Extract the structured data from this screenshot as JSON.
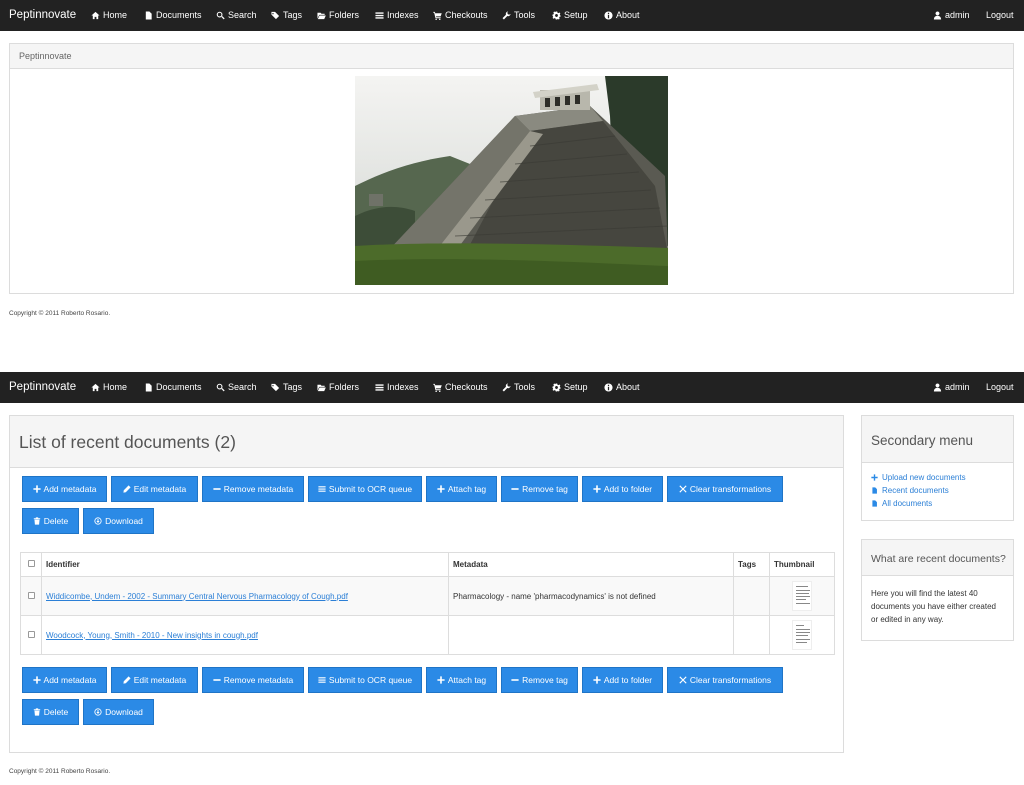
{
  "nav": {
    "brand": "Peptinnovate",
    "items": [
      {
        "label": "Home",
        "icon": "home-icon"
      },
      {
        "label": "Documents",
        "icon": "document-icon"
      },
      {
        "label": "Search",
        "icon": "search-icon"
      },
      {
        "label": "Tags",
        "icon": "tags-icon"
      },
      {
        "label": "Folders",
        "icon": "folder-open-icon"
      },
      {
        "label": "Indexes",
        "icon": "list-icon"
      },
      {
        "label": "Checkouts",
        "icon": "cart-icon"
      },
      {
        "label": "Tools",
        "icon": "wrench-icon"
      },
      {
        "label": "Setup",
        "icon": "gear-icon"
      },
      {
        "label": "About",
        "icon": "info-icon"
      }
    ],
    "user": "admin",
    "logout": "Logout"
  },
  "home_panel": {
    "title": "Peptinnovate"
  },
  "copyright": "Copyright © 2011 Roberto Rosario.",
  "main": {
    "title": "List of recent documents (2)",
    "actions": [
      {
        "label": "Add metadata",
        "icon": "plus-icon"
      },
      {
        "label": "Edit metadata",
        "icon": "pencil-icon"
      },
      {
        "label": "Remove metadata",
        "icon": "minus-icon"
      },
      {
        "label": "Submit to OCR queue",
        "icon": "list-icon"
      },
      {
        "label": "Attach tag",
        "icon": "plus-icon"
      },
      {
        "label": "Remove tag",
        "icon": "minus-icon"
      },
      {
        "label": "Add to folder",
        "icon": "plus-icon"
      },
      {
        "label": "Clear transformations",
        "icon": "close-icon"
      },
      {
        "label": "Delete",
        "icon": "trash-icon"
      },
      {
        "label": "Download",
        "icon": "download-icon"
      }
    ],
    "table": {
      "headers": {
        "identifier": "Identifier",
        "metadata": "Metadata",
        "tags": "Tags",
        "thumbnail": "Thumbnail"
      },
      "rows": [
        {
          "identifier": "Widdicombe, Undem - 2002 - Summary Central Nervous Pharmacology of Cough.pdf",
          "metadata": "Pharmacology - name 'pharmacodynamics' is not defined",
          "tags": ""
        },
        {
          "identifier": "Woodcock, Young, Smith - 2010 - New insights in cough.pdf",
          "metadata": "",
          "tags": ""
        }
      ]
    }
  },
  "sidebar": {
    "menu_title": "Secondary menu",
    "links": [
      "Upload new documents",
      "Recent documents",
      "All documents"
    ],
    "help_title": "What are recent documents?",
    "help_text": "Here you will find the latest 40 documents you have either created or edited in any way."
  },
  "colors": {
    "navbar": "#222222",
    "button": "#2b8ae6",
    "link": "#2b7fd6"
  }
}
